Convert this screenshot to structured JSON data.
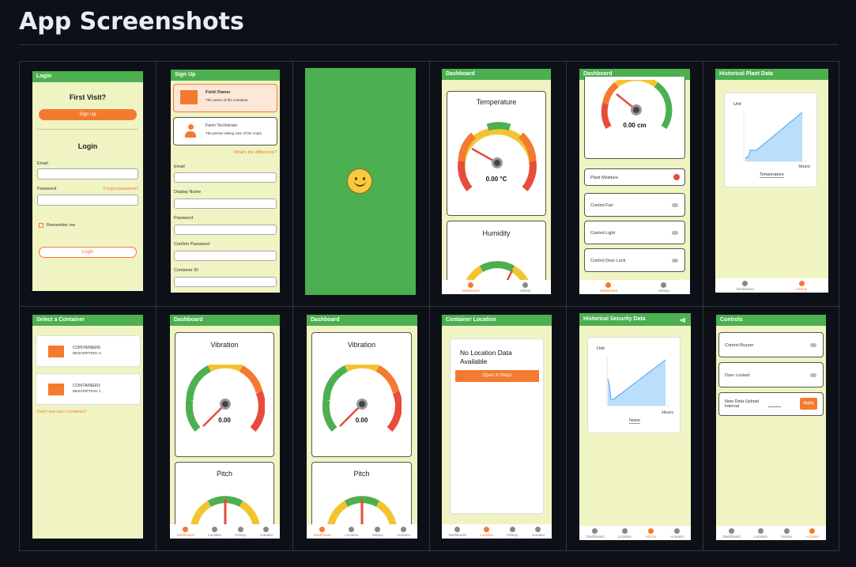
{
  "header": {
    "title": "App Screenshots"
  },
  "login": {
    "bar": "Login",
    "first_visit": "First Visit?",
    "signup_btn": "Sign Up",
    "login_heading": "Login",
    "email_label": "Email",
    "password_label": "Password",
    "forgot": "Forgot password?",
    "remember": "Remember me",
    "login_btn": "Login"
  },
  "signup": {
    "bar": "Sign Up",
    "roles": [
      {
        "title": "Field Owner",
        "desc": "The owner of the container."
      },
      {
        "title": "Farm Technician",
        "desc": "The person taking care of the crops."
      }
    ],
    "difference": "What's the difference?",
    "fields": [
      "Email",
      "Display Name",
      "Password",
      "Confirm Password",
      "Container ID"
    ]
  },
  "dash1": {
    "bar": "Dashboard",
    "temperature": {
      "title": "Temperature",
      "value": "0.00 °C",
      "ticks": [
        "8",
        "10",
        "12",
        "14",
        "16",
        "18",
        "20",
        "22",
        "24",
        "26",
        "28",
        "30"
      ]
    },
    "humidity": {
      "title": "Humidity",
      "ticks": [
        "20",
        "30",
        "40"
      ]
    },
    "nav": [
      "Dashboard",
      "History"
    ]
  },
  "dash2": {
    "bar": "Dashboard",
    "value": "0.00 cm",
    "ticks": [
      "0",
      "0.5",
      "0.8",
      "1.5",
      "2.3",
      "2.5",
      "5",
      "7",
      "8.0",
      "10",
      "12"
    ],
    "plant_moisture": "Plant Moisture",
    "controls": [
      "Control Fan",
      "Control Light",
      "Control Door Lock"
    ],
    "nav": [
      "Dashboard",
      "History"
    ]
  },
  "hist_plant": {
    "bar": "Historical Plant Data",
    "unit": "Unit",
    "xlabel": "Hours",
    "metric": "Temperature",
    "nav": [
      "Dashboard",
      "History"
    ]
  },
  "select": {
    "bar": "Select a Container",
    "containers": [
      {
        "name": "CONTAINER0",
        "desc": "DESCRIPTION: 0"
      },
      {
        "name": "CONTAINER1",
        "desc": "DESCRIPTION: 1"
      }
    ],
    "dont_see": "Don't see your container?"
  },
  "dash3": {
    "bar": "Dashboard",
    "vibration": {
      "title": "Vibration",
      "value": "0.00",
      "ticks": [
        "-60",
        "-40",
        "-20",
        "0",
        "20",
        "40",
        "60",
        "-80",
        "80"
      ]
    },
    "pitch": {
      "title": "Pitch",
      "ticks": [
        "-20",
        "0",
        "20"
      ]
    },
    "nav": [
      "Dashboard",
      "Location",
      "History",
      "Actuator"
    ]
  },
  "location": {
    "bar": "Container Location",
    "message": "No Location Data Available",
    "open_maps": "Open in Maps",
    "nav": [
      "Dashboard",
      "Location",
      "History",
      "Actuator"
    ]
  },
  "hist_security": {
    "bar": "Historical Security Data",
    "unit": "Unit",
    "xlabel": "Hours",
    "metric": "Noise",
    "nav": [
      "Dashboard",
      "Location",
      "History",
      "Actuator"
    ]
  },
  "controls": {
    "bar": "Controls",
    "buzzer": "Control Buzzer",
    "door_locked": "Door Locked",
    "upload": "New Data Upload Interval",
    "apply": "Apply",
    "nav": [
      "Dashboard",
      "Location",
      "History",
      "Actuator"
    ]
  },
  "colors": {
    "green": "#4caf50",
    "orange": "#f47a2f",
    "panel": "#f0f4c3",
    "chart_fill": "#bbdefb",
    "chart_line": "#42a5f5"
  }
}
